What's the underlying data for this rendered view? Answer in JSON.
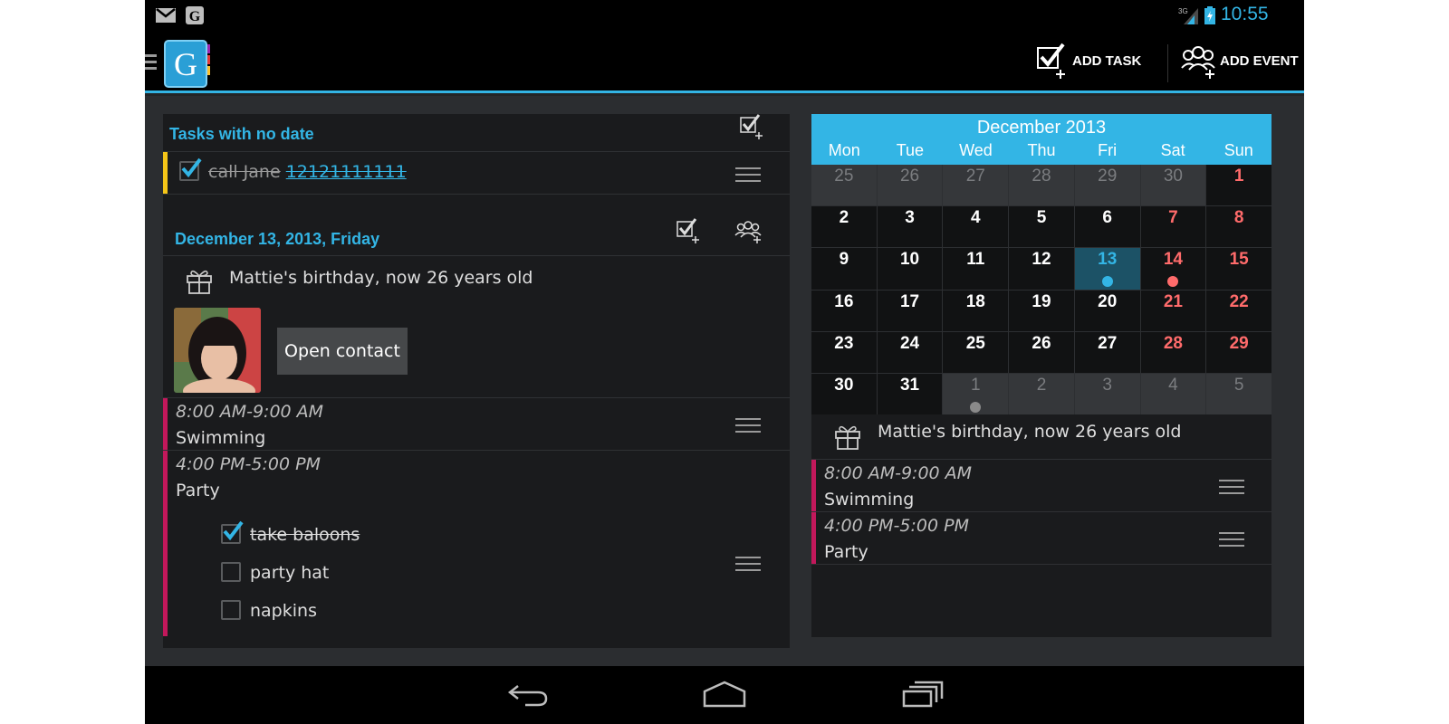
{
  "status_bar": {
    "icons": [
      "gmail-icon",
      "google-icon",
      "signal-3g-icon",
      "battery-charging-icon"
    ],
    "network": "3G",
    "time": "10:55"
  },
  "action_bar": {
    "app_icon": "g-calendar-app-icon",
    "add_task_label": "ADD TASK",
    "add_event_label": "ADD EVENT"
  },
  "left_panel": {
    "tasks_no_date": {
      "title": "Tasks with no date",
      "task": {
        "text": "call Jane",
        "phone": "12121111111",
        "done": true
      }
    },
    "day": {
      "title": "December 13, 2013, Friday",
      "birthday_text": "Mattie's birthday, now 26 years old",
      "open_contact_label": "Open contact",
      "events": [
        {
          "time": "8:00 AM-9:00 AM",
          "title": "Swimming"
        },
        {
          "time": "4:00 PM-5:00 PM",
          "title": "Party"
        }
      ],
      "party_tasks": [
        {
          "text": "take baloons",
          "done": true
        },
        {
          "text": "party hat",
          "done": false
        },
        {
          "text": "napkins",
          "done": false
        }
      ]
    }
  },
  "calendar": {
    "title": "December 2013",
    "weekdays": [
      "Mon",
      "Tue",
      "Wed",
      "Thu",
      "Fri",
      "Sat",
      "Sun"
    ],
    "days": [
      {
        "n": "25",
        "other": true
      },
      {
        "n": "26",
        "other": true
      },
      {
        "n": "27",
        "other": true
      },
      {
        "n": "28",
        "other": true
      },
      {
        "n": "29",
        "other": true
      },
      {
        "n": "30",
        "other": true
      },
      {
        "n": "1",
        "weekend": true
      },
      {
        "n": "2"
      },
      {
        "n": "3"
      },
      {
        "n": "4"
      },
      {
        "n": "5"
      },
      {
        "n": "6"
      },
      {
        "n": "7",
        "weekend": true
      },
      {
        "n": "8",
        "weekend": true
      },
      {
        "n": "9"
      },
      {
        "n": "10"
      },
      {
        "n": "11"
      },
      {
        "n": "12"
      },
      {
        "n": "13",
        "today": true,
        "dot": "#33b5e5"
      },
      {
        "n": "14",
        "weekend": true,
        "dot": "#ff6b6b"
      },
      {
        "n": "15",
        "weekend": true
      },
      {
        "n": "16"
      },
      {
        "n": "17"
      },
      {
        "n": "18"
      },
      {
        "n": "19"
      },
      {
        "n": "20"
      },
      {
        "n": "21",
        "weekend": true
      },
      {
        "n": "22",
        "weekend": true
      },
      {
        "n": "23"
      },
      {
        "n": "24"
      },
      {
        "n": "25"
      },
      {
        "n": "26"
      },
      {
        "n": "27"
      },
      {
        "n": "28",
        "weekend": true
      },
      {
        "n": "29",
        "weekend": true
      },
      {
        "n": "30"
      },
      {
        "n": "31"
      },
      {
        "n": "1",
        "other": true,
        "dot": "#8a8a8a"
      },
      {
        "n": "2",
        "other": true
      },
      {
        "n": "3",
        "other": true
      },
      {
        "n": "4",
        "other": true
      },
      {
        "n": "5",
        "other": true
      }
    ],
    "birthday_text": "Mattie's birthday, now 26 years old",
    "events": [
      {
        "time": "8:00 AM-9:00 AM",
        "title": "Swimming"
      },
      {
        "time": "4:00 PM-5:00 PM",
        "title": "Party"
      }
    ]
  },
  "colors": {
    "accent": "#33b5e5",
    "event_bar": "#c2185b",
    "task_bar": "#f5c518",
    "weekend": "#ff6b6b"
  }
}
